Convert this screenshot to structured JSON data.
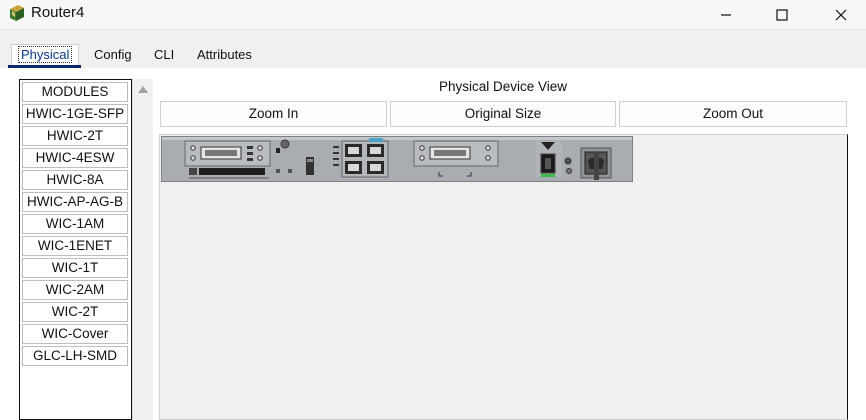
{
  "window": {
    "title": "Router4",
    "controls": {
      "minimize": "minimize",
      "maximize": "maximize",
      "close": "close"
    }
  },
  "tabs": [
    {
      "label": "Physical",
      "active": true
    },
    {
      "label": "Config",
      "active": false
    },
    {
      "label": "CLI",
      "active": false
    },
    {
      "label": "Attributes",
      "active": false
    }
  ],
  "modules": {
    "header": "MODULES",
    "items": [
      "HWIC-1GE-SFP",
      "HWIC-2T",
      "HWIC-4ESW",
      "HWIC-8A",
      "HWIC-AP-AG-B",
      "WIC-1AM",
      "WIC-1ENET",
      "WIC-1T",
      "WIC-2AM",
      "WIC-2T",
      "WIC-Cover",
      "GLC-LH-SMD"
    ]
  },
  "device_view": {
    "title": "Physical Device View",
    "zoom_in": "Zoom In",
    "original_size": "Original Size",
    "zoom_out": "Zoom Out"
  },
  "colors": {
    "tab_underline": "#0b2a6a",
    "chassis": "#a9adb2",
    "canvas_bg": "#f0f0f0"
  }
}
